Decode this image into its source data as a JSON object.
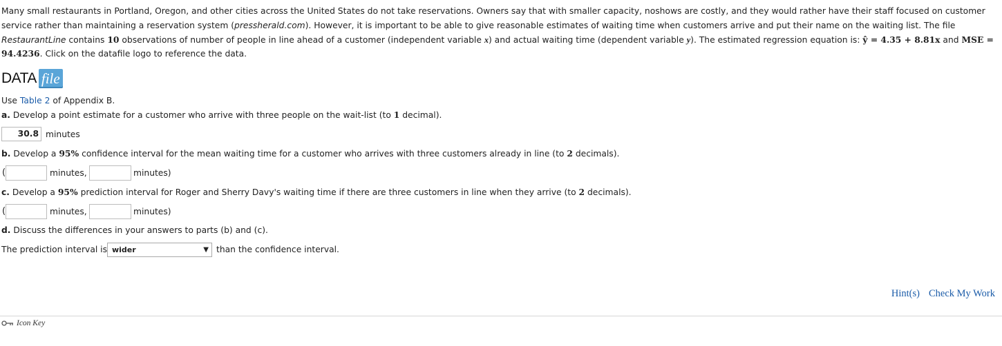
{
  "intro": {
    "p1": "Many small restaurants in Portland, Oregon, and other cities across the United States do not take reservations. Owners say that with smaller capacity, noshows are costly, and they would rather have their staff focused on customer service rather than maintaining a reservation system (",
    "source": "pressherald.com",
    "p2": "). However, it is important to be able to give reasonable estimates of waiting time when customers arrive and put their name on the waiting list. The file ",
    "filename": "RestaurantLine",
    "p3": " contains ",
    "n_obs": "10",
    "p4": " observations of number of people in line ahead of a customer (independent variable ",
    "var_x": "x",
    "p5": ") and actual waiting time (dependent variable ",
    "var_y": "y",
    "p6": "). The estimated regression equation is: ",
    "equation": "ŷ = 4.35 + 8.81x",
    "p7": " and ",
    "mse": "MSE = 94.4236",
    "p8": ". Click on the datafile logo to reference the data."
  },
  "datafile": {
    "data_word": "DATA",
    "file_word": "file"
  },
  "use_table": {
    "prefix": "Use ",
    "link": "Table 2",
    "suffix": " of Appendix B."
  },
  "part_a": {
    "letter": "a.",
    "q1": " Develop a point estimate for a customer who arrive with three people on the wait-list (to ",
    "precision": "1",
    "q2": " decimal).",
    "answer": "30.8",
    "unit": "minutes"
  },
  "part_b": {
    "letter": "b.",
    "q1": " Develop a ",
    "pct": "95%",
    "q2": " confidence interval for the mean waiting time for a customer who arrives with three customers already in line (to ",
    "precision": "2",
    "q3": " decimals).",
    "open_paren": "(",
    "unit1": "minutes,",
    "unit2": "minutes)",
    "lower": "",
    "upper": ""
  },
  "part_c": {
    "letter": "c.",
    "q1": " Develop a ",
    "pct": "95%",
    "q2": " prediction interval for Roger and Sherry Davy's waiting time if there are three customers in line when they arrive (to ",
    "precision": "2",
    "q3": " decimals).",
    "open_paren": "(",
    "unit1": "minutes,",
    "unit2": "minutes)",
    "lower": "",
    "upper": ""
  },
  "part_d": {
    "letter": "d.",
    "question": " Discuss the differences in your answers to parts (b) and (c).",
    "prefix": "The prediction interval is",
    "selected": "wider",
    "suffix": "than the confidence interval."
  },
  "links": {
    "hint": "Hint(s)",
    "check": "Check My Work"
  },
  "icon_key": {
    "label": "Icon Key",
    "icon": "key-icon"
  },
  "colors": {
    "link": "#1a5ba8",
    "file_badge": "#5aa5d8"
  }
}
